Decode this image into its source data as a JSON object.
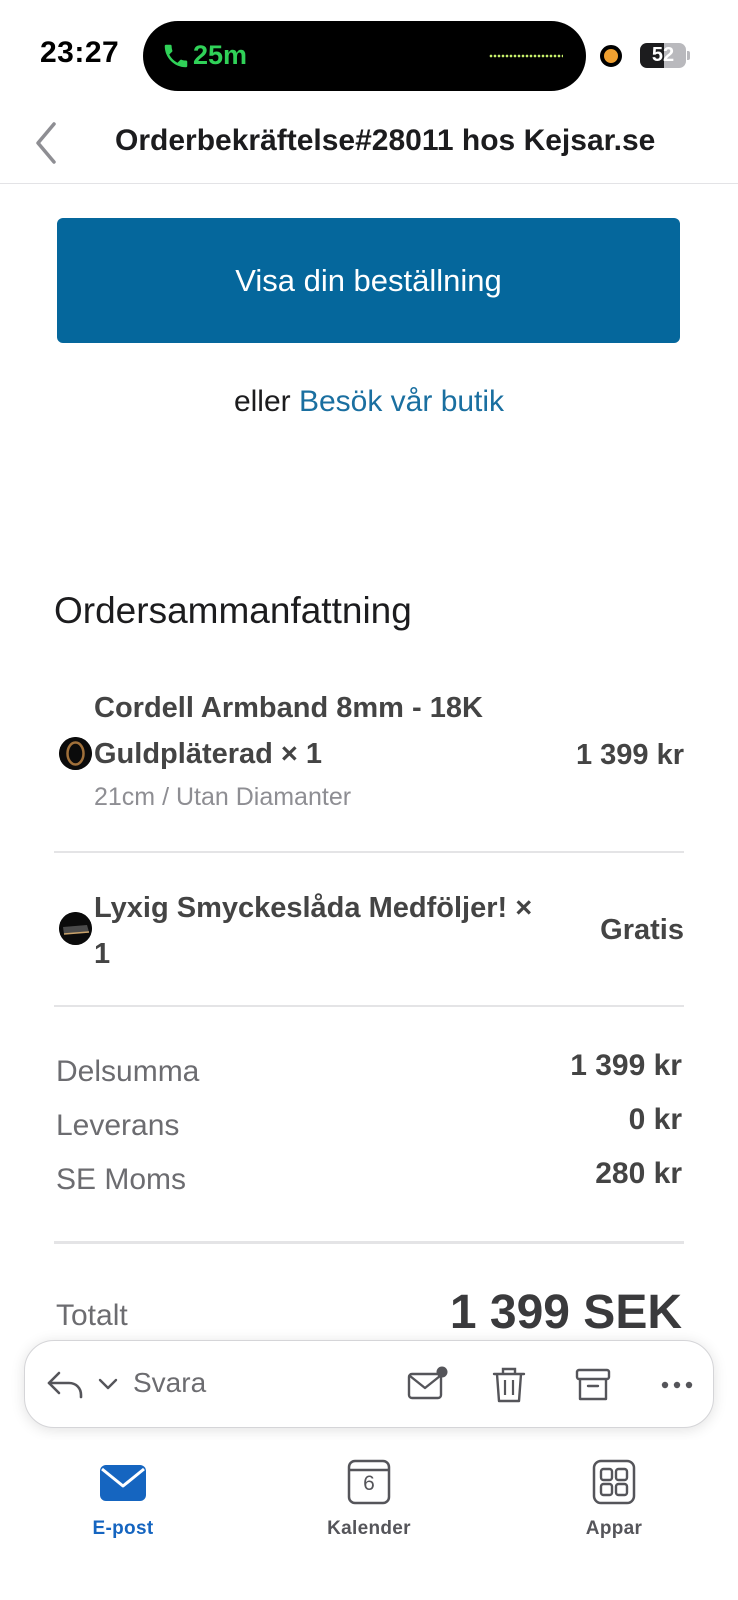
{
  "status_bar": {
    "time": "23:27",
    "call_duration": "25m",
    "battery_level": "52"
  },
  "header": {
    "title": "Orderbekräftelse#28011 hos Kejsar.se"
  },
  "email": {
    "cta_button": "Visa din beställning",
    "or_text": "eller ",
    "store_link": "Besök vår butik",
    "summary_title": "Ordersammanfattning",
    "items": [
      {
        "name": "Cordell Armband 8mm - 18K Guldpläterad × 1",
        "variant": "21cm / Utan Diamanter",
        "price": "1 399 kr"
      },
      {
        "name": "Lyxig Smyckeslåda Medföljer! × 1",
        "price": "Gratis"
      }
    ],
    "subtotal": {
      "label": "Delsumma",
      "value": "1 399 kr"
    },
    "shipping": {
      "label": "Leverans",
      "value": "0 kr"
    },
    "tax": {
      "label": "SE Moms",
      "value": "280 kr"
    },
    "total": {
      "label": "Totalt",
      "value": "1 399 SEK"
    }
  },
  "toolbar": {
    "reply_label": "Svara"
  },
  "tabs": [
    {
      "label": "E-post",
      "active": true
    },
    {
      "label": "Kalender",
      "badge": "6"
    },
    {
      "label": "Appar"
    }
  ],
  "colors": {
    "accent": "#1565c0",
    "cta_background": "#05679c",
    "link": "#1a6fa0",
    "call_green": "#30d158"
  }
}
